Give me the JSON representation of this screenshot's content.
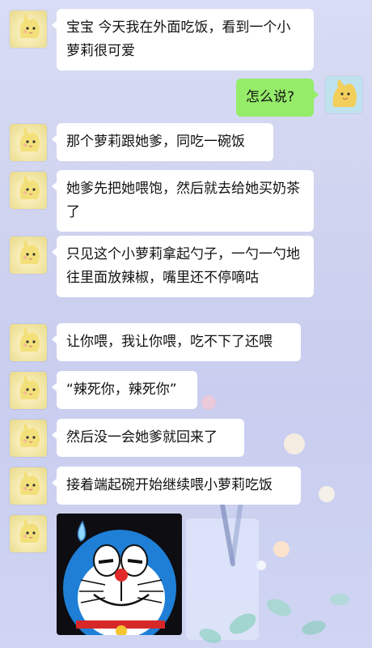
{
  "messages": [
    {
      "side": "left",
      "text": "宝宝  今天我在外面吃饭，看到一个小萝莉很可爱"
    },
    {
      "side": "right",
      "text": "怎么说?"
    },
    {
      "side": "left",
      "text": "那个萝莉跟她爹，同吃一碗饭"
    },
    {
      "side": "left",
      "text": "她爹先把她喂饱，然后就去给她买奶茶了"
    },
    {
      "side": "left",
      "text": "只见这个小萝莉拿起勺子，一勺一勺地往里面放辣椒，嘴里还不停嘀咕"
    },
    {
      "side": "left",
      "text": "让你喂，我让你喂，吃不下了还喂"
    },
    {
      "side": "left",
      "text": "“辣死你，辣死你”"
    },
    {
      "side": "left",
      "text": "然后没一会她爹就回来了"
    },
    {
      "side": "left",
      "text": "接着端起碗开始继续喂小萝莉吃饭"
    }
  ],
  "sticker": {
    "name": "doraemon-sweating-sticker"
  },
  "colors": {
    "bubble_left": "#ffffff",
    "bubble_right": "#95ec69",
    "background": "#cfd3ef"
  }
}
